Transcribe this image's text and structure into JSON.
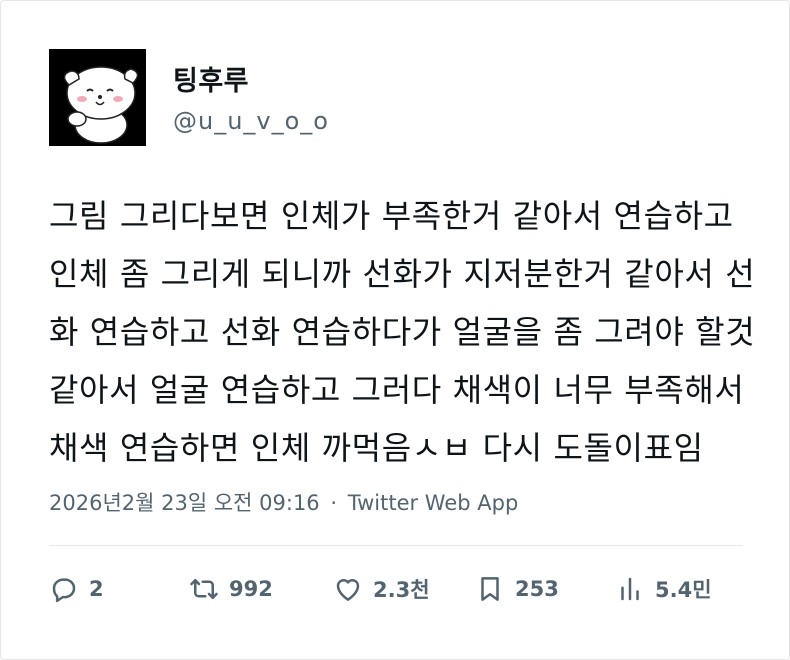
{
  "user": {
    "display_name": "팅후루",
    "handle": "@u_u_v_o_o",
    "avatar_icon": "puppy-doodle-avatar"
  },
  "tweet": {
    "lines": [
      "그림 그리다보면 인체가 부족한거 같아서 연습하고",
      "인체 좀 그리게 되니까 선화가 지저분한거 같아서 선",
      "화 연습하고 선화 연습하다가 얼굴을 좀 그려야 할것",
      "같아서 얼굴 연습하고 그러다 채색이 너무 부족해서",
      "채색 연습하면 인체 까먹음ㅅㅂ 다시 도돌이표임"
    ]
  },
  "meta": {
    "timestamp": "2026년2월 23일 오전 09:16",
    "separator": "·",
    "source": "Twitter Web App"
  },
  "actions": {
    "replies": "2",
    "retweets": "992",
    "likes": "2.3천",
    "bookmarks": "253",
    "views": "5.4민"
  },
  "colors": {
    "text": "#0f1419",
    "secondary": "#536471",
    "divider": "#e6e6e6"
  }
}
